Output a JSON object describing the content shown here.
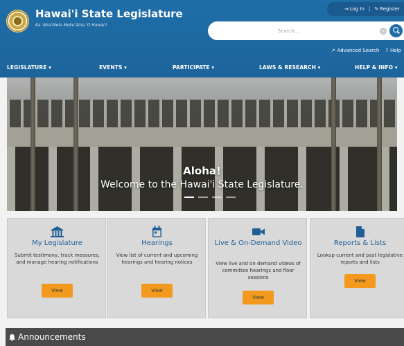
{
  "header": {
    "title": "Hawai'i State Legislature",
    "motto": "Ka 'Aha'ōlelo Moku'āina 'O Hawai'i",
    "account": {
      "login": "Log In",
      "separator": "|",
      "register": "Register"
    },
    "search": {
      "placeholder": "Search..."
    },
    "utility": {
      "advanced_search": "Advanced Search",
      "help": "Help"
    },
    "nav": [
      "LEGISLATURE ▾",
      "EVENTS ▾",
      "PARTICIPATE ▾",
      "LAWS & RESEARCH ▾",
      "HELP & INFO ▾"
    ]
  },
  "hero": {
    "title": "Aloha!",
    "subtitle": "Welcome to the Hawai'i State Legislature."
  },
  "cards": [
    {
      "icon": "capitol-icon",
      "title": "My Legislature",
      "desc": "Submit testimony, track measures, and manage hearing notifications",
      "button": "View"
    },
    {
      "icon": "calendar-icon",
      "title": "Hearings",
      "desc": "View list of current and upcoming hearings and hearing notices",
      "button": "View"
    },
    {
      "icon": "video-icon",
      "title": "Live & On-Demand Video",
      "desc": "View live and on demand videos of committee hearings and floor sessions",
      "button": "View"
    },
    {
      "icon": "document-icon",
      "title": "Reports & Lists",
      "desc": "Lookup current and past legislative reports and lists",
      "button": "View"
    }
  ],
  "announcements": {
    "title": "Announcements"
  },
  "colors": {
    "header_blue": "#1f6ea8",
    "accent_orange": "#f39a1e",
    "card_title_blue": "#1f5f95"
  }
}
